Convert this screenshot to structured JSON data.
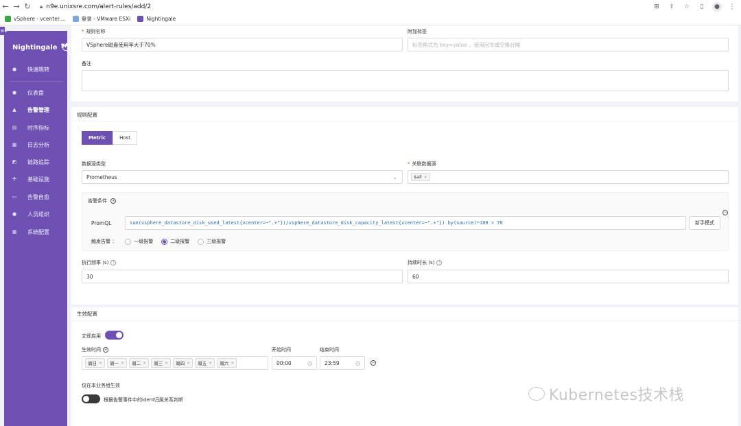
{
  "browser": {
    "url": "n9e.unixsre.com/alert-rules/add/2",
    "bookmarks": [
      {
        "label": "vSphere - vcenter...."
      },
      {
        "label": "登录 - VMware ESXi"
      },
      {
        "label": "Nightingale"
      }
    ]
  },
  "sidebar": {
    "brand": "Nightingale",
    "items": [
      {
        "label": "快速跳转",
        "icon": "search-icon"
      },
      {
        "label": "仪表盘",
        "icon": "dashboard-icon"
      },
      {
        "label": "告警管理",
        "icon": "bell-icon"
      },
      {
        "label": "时序指标",
        "icon": "chart-icon"
      },
      {
        "label": "日志分析",
        "icon": "log-icon"
      },
      {
        "label": "链路追踪",
        "icon": "trace-icon"
      },
      {
        "label": "基础设施",
        "icon": "infra-icon"
      },
      {
        "label": "告警自愈",
        "icon": "heal-icon"
      },
      {
        "label": "人员组织",
        "icon": "user-icon"
      },
      {
        "label": "系统配置",
        "icon": "settings-icon"
      }
    ]
  },
  "form": {
    "rule_name_label": "规则名称",
    "rule_name_value": "VSphere磁盘使用率大于70%",
    "extra_tags_label": "附加标签",
    "extra_tags_placeholder": "标签格式为 key=value ，使用回车或空格分隔",
    "note_label": "备注"
  },
  "rule_config": {
    "title": "规则配置",
    "tabs": [
      "Metric",
      "Host"
    ],
    "datasource_type_label": "数据源类型",
    "datasource_type_value": "Prometheus",
    "linked_datasource_label": "关联数据源",
    "linked_datasource_tag": "$all",
    "condition_label": "告警条件",
    "promql_label": "PromQL",
    "promql_value": "sum(vsphere_datastore_disk_used_latest{vcenter=~\".+\"})/vsphere_datastore_disk_capacity_latest{vcenter=~\".+\"}) by(source)*100 > 70",
    "novice_mode": "新手模式",
    "trigger_label": "触发告警",
    "levels": [
      "一级报警",
      "二级报警",
      "三级报警"
    ],
    "selected_level": "二级报警",
    "frequency_label": "执行频率 (s)",
    "frequency_value": "30",
    "duration_label": "持续时长 (s)",
    "duration_value": "60"
  },
  "effective_config": {
    "title": "生效配置",
    "enable_label": "立即启用",
    "enable_on": true,
    "effective_time_label": "生效时间",
    "days": [
      "周日",
      "周一",
      "周二",
      "周三",
      "周四",
      "周五",
      "周六"
    ],
    "start_label": "开始时间",
    "start_value": "00:00",
    "end_label": "结束时间",
    "end_value": "23:59",
    "biz_only_label": "仅在本业务组生效",
    "biz_only_on": false,
    "biz_only_desc": "根据告警事件中的ident归属关系判断"
  },
  "watermark": "Kubernetes技术栈",
  "colors": {
    "accent": "#6e50b3",
    "promql": "#2b6cb0",
    "required": "#e3453a"
  }
}
